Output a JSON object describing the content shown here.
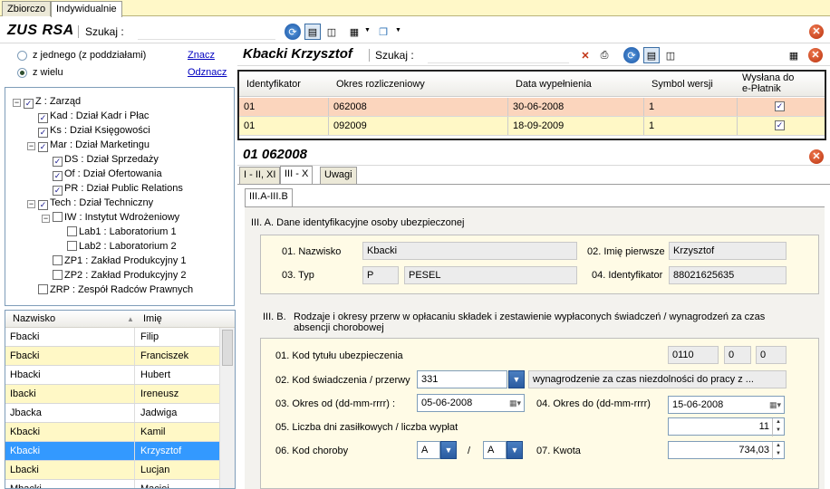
{
  "tabs": [
    "Zbiorczo",
    "Indywidualnie"
  ],
  "app": {
    "title": "ZUS RSA",
    "search_label": "Szukaj :"
  },
  "filter": {
    "option1": "z jednego (z poddziałami)",
    "option2": "z wielu",
    "link_check": "Znacz",
    "link_uncheck": "Odznacz"
  },
  "tree": [
    {
      "label": "Z : Zarząd",
      "checked": true
    },
    {
      "label": "Kad : Dział Kadr i Płac",
      "checked": true
    },
    {
      "label": "Ks : Dział Księgowości",
      "checked": true
    },
    {
      "label": "Mar : Dział Marketingu",
      "checked": true
    },
    {
      "label": "DS : Dział Sprzedaży",
      "checked": true
    },
    {
      "label": "Of : Dział Ofertowania",
      "checked": true
    },
    {
      "label": "PR : Dział Public Relations",
      "checked": true
    },
    {
      "label": "Tech : Dział Techniczny",
      "checked": true
    },
    {
      "label": "IW : Instytut Wdrożeniowy",
      "checked": false
    },
    {
      "label": "Lab1 : Laboratorium 1",
      "checked": false
    },
    {
      "label": "Lab2 : Laboratorium 2",
      "checked": false
    },
    {
      "label": "ZP1 : Zakład Produkcyjny 1",
      "checked": false
    },
    {
      "label": "ZP2 : Zakład Produkcyjny 2",
      "checked": false
    },
    {
      "label": "ZRP : Zespół Radców Prawnych",
      "checked": false
    }
  ],
  "people": {
    "col_surname": "Nazwisko",
    "col_name": "Imię",
    "rows": [
      [
        "Fbacki",
        "Filip"
      ],
      [
        "Fbacki",
        "Franciszek"
      ],
      [
        "Hbacki",
        "Hubert"
      ],
      [
        "Ibacki",
        "Ireneusz"
      ],
      [
        "Jbacka",
        "Jadwiga"
      ],
      [
        "Kbacki",
        "Kamil"
      ],
      [
        "Kbacki",
        "Krzysztof"
      ],
      [
        "Lbacki",
        "Lucjan"
      ],
      [
        "Mbacki",
        "Maciej"
      ]
    ]
  },
  "person": {
    "title": "Kbacki Krzysztof",
    "search_label": "Szukaj :"
  },
  "reports": {
    "cols": [
      "Identyfikator",
      "Okres rozliczeniowy",
      "Data wypełnienia",
      "Symbol wersji",
      "Wysłana do e-Płatnik"
    ],
    "rows": [
      [
        "01",
        "062008",
        "30-06-2008",
        "1"
      ],
      [
        "01",
        "092009",
        "18-09-2009",
        "1"
      ]
    ]
  },
  "detail": {
    "title": "01 062008",
    "tabs": [
      "I - II, XI",
      "III - X",
      "Uwagi"
    ],
    "subtab": "III.A-III.B",
    "secA": {
      "title": "III. A. Dane identyfikacyjne osoby ubezpieczonej",
      "l_nazwisko": "01. Nazwisko",
      "v_nazwisko": "Kbacki",
      "l_imie": "02. Imię pierwsze",
      "v_imie": "Krzysztof",
      "l_typ": "03. Typ",
      "v_typ": "P",
      "v_typ_desc": "PESEL",
      "l_id": "04. Identyfikator",
      "v_id": "88021625635"
    },
    "secB": {
      "title_a": "III. B.",
      "title_b": "Rodzaje i okresy przerw w opłacaniu składek i zestawienie wypłaconych świadczeń / wynagrodzeń za czas",
      "title_c": "absencji chorobowej",
      "l_kod_tyt": "01. Kod tytułu ubezpieczenia",
      "v_kod_tyt": [
        "0110",
        "0",
        "0"
      ],
      "l_kod_sw": "02. Kod świadczenia / przerwy",
      "v_kod_sw": "331",
      "v_kod_sw_desc": "wynagrodzenie za czas niezdolności do pracy z ...",
      "l_od": "03. Okres od (dd-mm-rrrr) :",
      "v_od": "05-06-2008",
      "l_do": "04. Okres do (dd-mm-rrrr)",
      "v_do": "15-06-2008",
      "l_dni": "05. Liczba dni zasiłkowych / liczba wypłat",
      "v_dni": "11",
      "l_choroba": "06. Kod choroby",
      "v_ch1": "A",
      "sep": "/",
      "v_ch2": "A",
      "l_kwota": "07. Kwota",
      "v_kwota": "734,03"
    }
  }
}
